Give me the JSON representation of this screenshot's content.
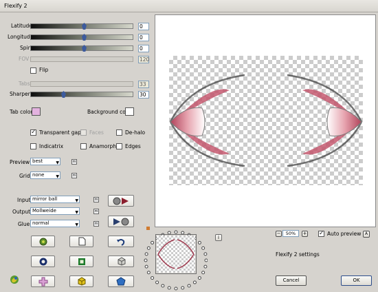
{
  "window": {
    "title": "Flexify 2"
  },
  "sliders": [
    {
      "label": "Latitude",
      "value": "0",
      "pos": 0.52,
      "disabled": false
    },
    {
      "label": "Longitude",
      "value": "0",
      "pos": 0.52,
      "disabled": false
    },
    {
      "label": "Spin",
      "value": "0",
      "pos": 0.52,
      "disabled": false
    },
    {
      "label": "FOV",
      "value": "120",
      "disabled": true
    }
  ],
  "flip": {
    "label": "Flip",
    "checked": false
  },
  "tabs": {
    "label": "Tabs",
    "value": "33",
    "disabled": true
  },
  "sharpen": {
    "label": "Sharpen",
    "value": "30",
    "pos": 0.32
  },
  "colors": {
    "tab_label": "Tab color",
    "tab_color": "#e3b2df",
    "bg_label": "Background color",
    "bg_color": "#ffffff",
    "accent": "#3d5b9e"
  },
  "options": {
    "transparent_gaps": {
      "label": "Transparent gaps",
      "checked": true
    },
    "faces": {
      "label": "Faces",
      "checked": false,
      "disabled": true
    },
    "de_halo": {
      "label": "De-halo",
      "checked": false
    },
    "indicatrix": {
      "label": "Indicatrix",
      "checked": false
    },
    "anamorph": {
      "label": "Anamorph",
      "checked": false
    },
    "edges": {
      "label": "Edges",
      "checked": false
    }
  },
  "preview_quality": {
    "label": "Preview",
    "value": "best"
  },
  "grid": {
    "label": "Grid",
    "value": "none"
  },
  "input": {
    "label": "Input",
    "value": "mirror ball"
  },
  "output": {
    "label": "Output",
    "value": "Mollweide"
  },
  "glue": {
    "label": "Glue",
    "value": "normal"
  },
  "small_btn": "m",
  "zoom": {
    "minus": "−",
    "value": "50%",
    "plus": "+"
  },
  "auto_preview": {
    "label": "Auto preview",
    "checked": true
  },
  "preset_name": "Flexify 2 settings",
  "info_btn": "i",
  "cancel_label": "Cancel",
  "ok_label": "OK",
  "help_btn": "A"
}
